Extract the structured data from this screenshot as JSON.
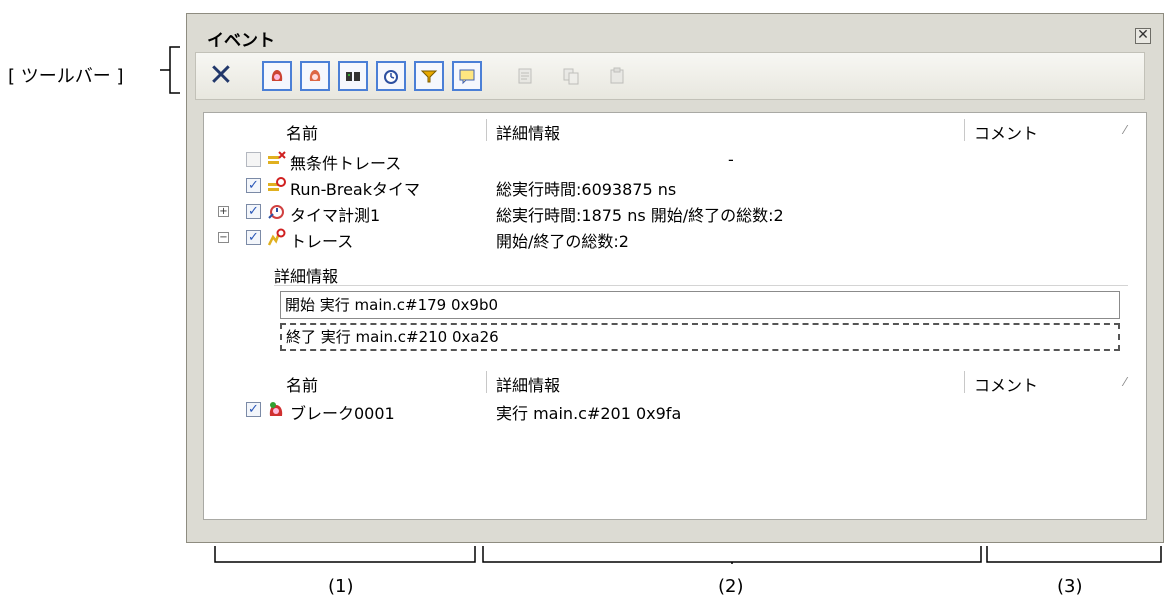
{
  "callouts": {
    "toolbar_label": "[ ツールバー ]",
    "col1": "(1)",
    "col2": "(2)",
    "col3": "(3)"
  },
  "panel": {
    "title": "イベント",
    "close_glyph": "✕"
  },
  "toolbar": {
    "delete_glyph": "✕",
    "buttons": [
      {
        "icon": "hardware-break-icon",
        "enabled": true
      },
      {
        "icon": "software-break-icon",
        "enabled": true
      },
      {
        "icon": "trace-icon",
        "enabled": true
      },
      {
        "icon": "timer-icon",
        "enabled": true
      },
      {
        "icon": "filter-icon",
        "enabled": true
      },
      {
        "icon": "comment-icon",
        "enabled": true
      },
      {
        "icon": "edit-condition-icon",
        "enabled": false
      },
      {
        "icon": "copy-icon",
        "enabled": false
      },
      {
        "icon": "paste-icon",
        "enabled": false
      }
    ]
  },
  "columns": {
    "name": "名前",
    "detail": "詳細情報",
    "comment": "コメント",
    "resize_glyph": "⁄"
  },
  "events": [
    {
      "name": "無条件トレース",
      "detail": "-",
      "checked": false,
      "expander": "",
      "icon": "unconditional-trace-icon"
    },
    {
      "name": "Run-Breakタイマ",
      "detail": "総実行時間:6093875 ns",
      "checked": true,
      "expander": "",
      "icon": "run-break-timer-icon"
    },
    {
      "name": "タイマ計測1",
      "detail": "総実行時間:1875 ns  開始/終了の総数:2",
      "checked": true,
      "expander": "+",
      "icon": "timer-measure-icon"
    },
    {
      "name": "トレース",
      "detail": "開始/終了の総数:2",
      "checked": true,
      "expander": "−",
      "icon": "trace-event-icon"
    }
  ],
  "trace_detail": {
    "header": "詳細情報",
    "start": "開始  実行  main.c#179  0x9b0",
    "end": "終了  実行  main.c#210  0xa26"
  },
  "break_section": {
    "name_header": "名前",
    "detail_header": "詳細情報",
    "comment_header": "コメント",
    "event": {
      "name": "ブレーク0001",
      "detail": "実行  main.c#201  0x9fa",
      "checked": true
    }
  },
  "colors": {
    "panel_bg": "#dcdbd3",
    "toolbar_accent": "#4b7fd6",
    "delete_icon": "#22386b"
  }
}
